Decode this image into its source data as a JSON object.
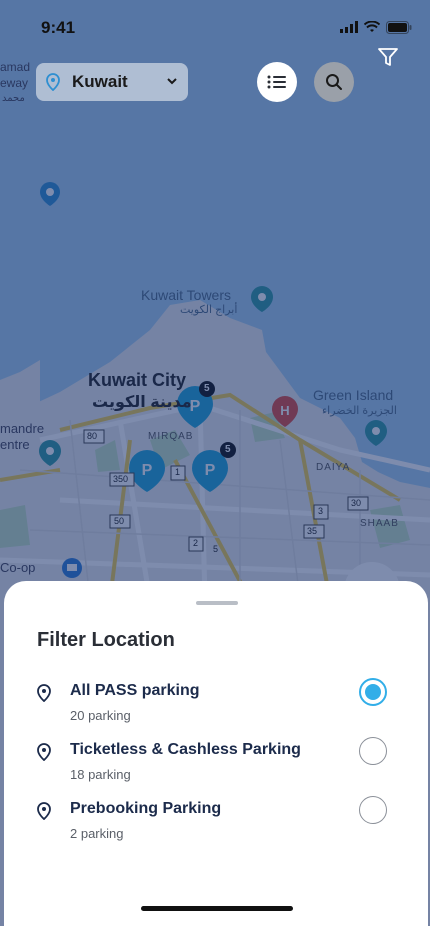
{
  "status_bar": {
    "time": "9:41"
  },
  "header": {
    "country_selector": {
      "value": "Kuwait"
    },
    "list_view_icon": "list-icon",
    "search_icon": "search-icon",
    "filter_icon": "filter-icon"
  },
  "map": {
    "labels": {
      "kuwait_towers": "Kuwait Towers",
      "kuwait_towers_ar": "أبراج الكويت",
      "kuwait_city": "Kuwait City",
      "kuwait_city_ar": "مدينة الكويت",
      "green_island": "Green Island",
      "green_island_ar": "الجزيرة الخضراء",
      "mirqab": "MIRQAB",
      "daiya": "DAIYA",
      "shaab": "SHAAB",
      "left_edge_1": "amad",
      "left_edge_2": "eway",
      "left_edge_ar": "محمد",
      "left_edge_3": "mandre",
      "left_edge_4": "entre",
      "left_edge_5": "Co-op"
    },
    "road_shields": [
      "80",
      "350",
      "50",
      "1",
      "2",
      "3",
      "30",
      "35",
      "5"
    ],
    "cluster_counts": [
      "5",
      "5"
    ]
  },
  "sheet": {
    "title": "Filter Location",
    "options": [
      {
        "name": "All PASS parking",
        "count": "20 parking",
        "selected": true
      },
      {
        "name": "Ticketless & Cashless Parking",
        "count": "18 parking",
        "selected": false
      },
      {
        "name": "Prebooking Parking",
        "count": "2 parking",
        "selected": false
      }
    ]
  },
  "colors": {
    "accent": "#32aee8",
    "map_dim_overlay": "#142d69",
    "parking_pin": "#1fa6d8",
    "hospital_pin": "#e04a3c"
  }
}
